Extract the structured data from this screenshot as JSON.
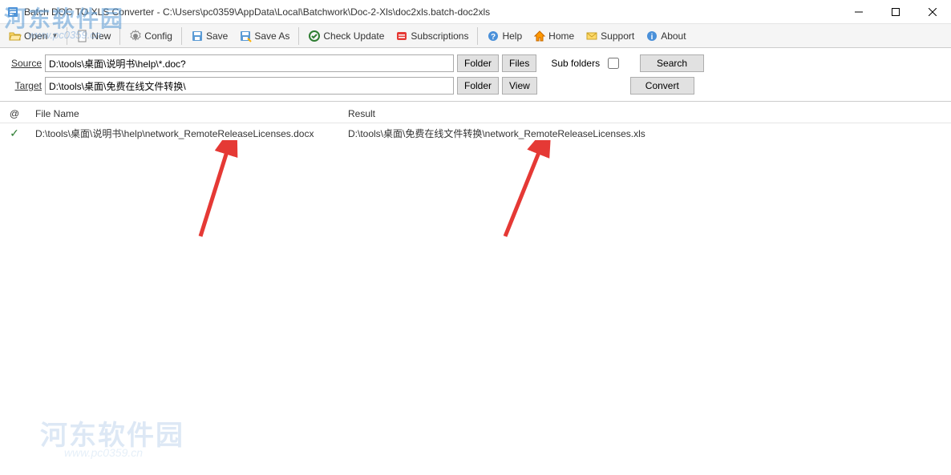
{
  "titlebar": {
    "title": "Batch DOC TO XLS Converter - C:\\Users\\pc0359\\AppData\\Local\\Batchwork\\Doc-2-Xls\\doc2xls.batch-doc2xls"
  },
  "toolbar": {
    "open": "Open",
    "new": "New",
    "config": "Config",
    "save": "Save",
    "save_as": "Save As",
    "check_update": "Check Update",
    "subscriptions": "Subscriptions",
    "help": "Help",
    "home": "Home",
    "support": "Support",
    "about": "About"
  },
  "paths": {
    "source_label": "Source",
    "source_value": "D:\\tools\\桌面\\说明书\\help\\*.doc?",
    "target_label": "Target",
    "target_value": "D:\\tools\\桌面\\免费在线文件转换\\",
    "folder_btn": "Folder",
    "files_btn": "Files",
    "view_btn": "View",
    "sub_folders_label": "Sub folders",
    "search_btn": "Search",
    "convert_btn": "Convert"
  },
  "table": {
    "col_at": "@",
    "col_filename": "File Name",
    "col_result": "Result",
    "rows": [
      {
        "status": "✓",
        "filename": "D:\\tools\\桌面\\说明书\\help\\network_RemoteReleaseLicenses.docx",
        "result": "D:\\tools\\桌面\\免费在线文件转换\\network_RemoteReleaseLicenses.xls"
      }
    ]
  },
  "watermark": {
    "main": "河东软件园",
    "sub": "www.pc0359.cn"
  }
}
